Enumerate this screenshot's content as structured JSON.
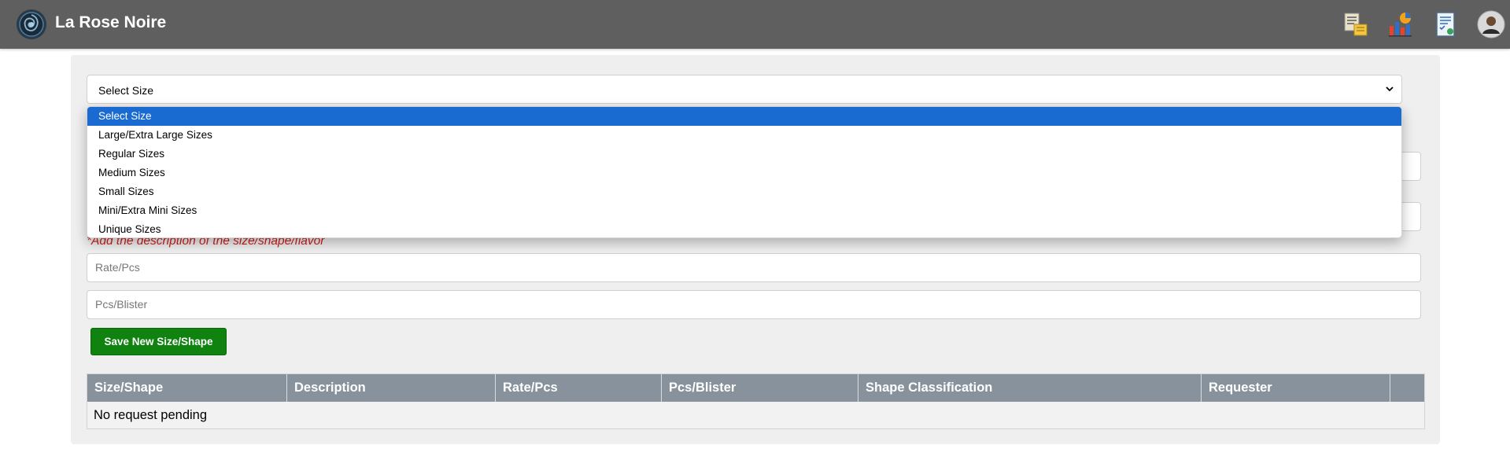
{
  "header": {
    "brand": "La Rose Noire",
    "icons": [
      "transfer-notes-icon",
      "chart-icon",
      "report-icon",
      "user-avatar-icon"
    ]
  },
  "form": {
    "size_select": {
      "value": "Select Size",
      "options": [
        "Select Size",
        "Large/Extra Large Sizes",
        "Regular Sizes",
        "Medium Sizes",
        "Small Sizes",
        "Mini/Extra Mini Sizes",
        "Unique Sizes"
      ],
      "selected_index": 0
    },
    "hint": "*Add the description of the size/shape/flavor",
    "rate_placeholder": "Rate/Pcs",
    "pcs_placeholder": "Pcs/Blister",
    "save_label": "Save New Size/Shape"
  },
  "table": {
    "headers": [
      "Size/Shape",
      "Description",
      "Rate/Pcs",
      "Pcs/Blister",
      "Shape Classification",
      "Requester",
      ""
    ],
    "empty_message": "No request pending"
  },
  "colors": {
    "topbar": "#5f5f5f",
    "accent_select": "#1a6bd1",
    "save_button": "#108210",
    "hint_red": "#d21b1b",
    "table_header": "#87929c"
  }
}
